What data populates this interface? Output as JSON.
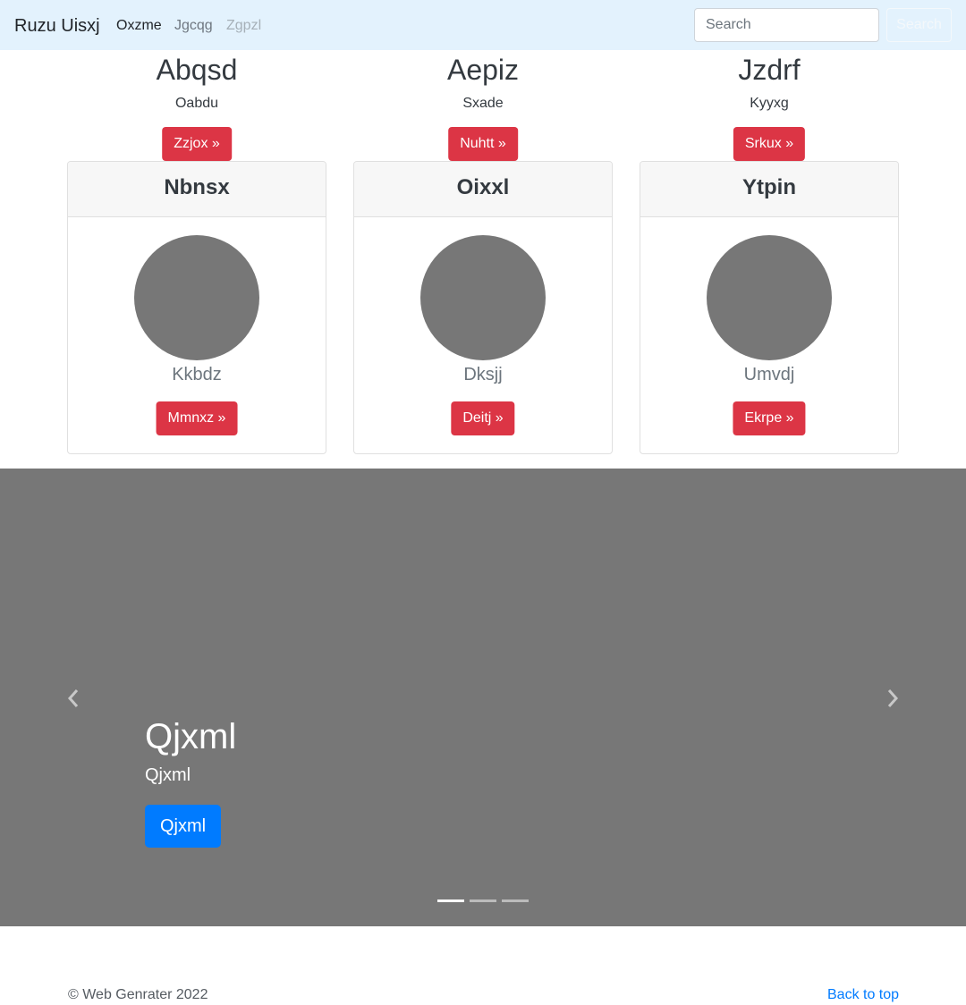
{
  "navbar": {
    "brand": "Ruzu Uisxj",
    "links": [
      "Oxzme",
      "Jgcqg",
      "Zgpzl"
    ],
    "search": {
      "placeholder": "Search",
      "value": ""
    },
    "search_button": "Search"
  },
  "top_columns": [
    {
      "title": "Abqsd",
      "text": "Oabdu",
      "button": "Zzjox »"
    },
    {
      "title": "Aepiz",
      "text": "Sxade",
      "button": "Nuhtt »"
    },
    {
      "title": "Jzdrf",
      "text": "Kyyxg",
      "button": "Srkux »"
    }
  ],
  "cards": [
    {
      "header": "Nbnsx",
      "name": "Kkbdz",
      "button": "Mmnxz »"
    },
    {
      "header": "Oixxl",
      "name": "Dksjj",
      "button": "Deitj »"
    },
    {
      "header": "Ytpin",
      "name": "Umvdj",
      "button": "Ekrpe »"
    }
  ],
  "carousel": {
    "title": "Qjxml",
    "subtitle": "Qjxml",
    "button": "Qjxml",
    "slide_count": 3,
    "active_index": 0
  },
  "footer": {
    "copyright": "© Web Genrater 2022",
    "back_to_top": "Back to top"
  },
  "colors": {
    "navbar_bg": "#e3f2fd",
    "danger": "#dc3545",
    "primary": "#007bff",
    "placeholder_gray": "#777777"
  }
}
